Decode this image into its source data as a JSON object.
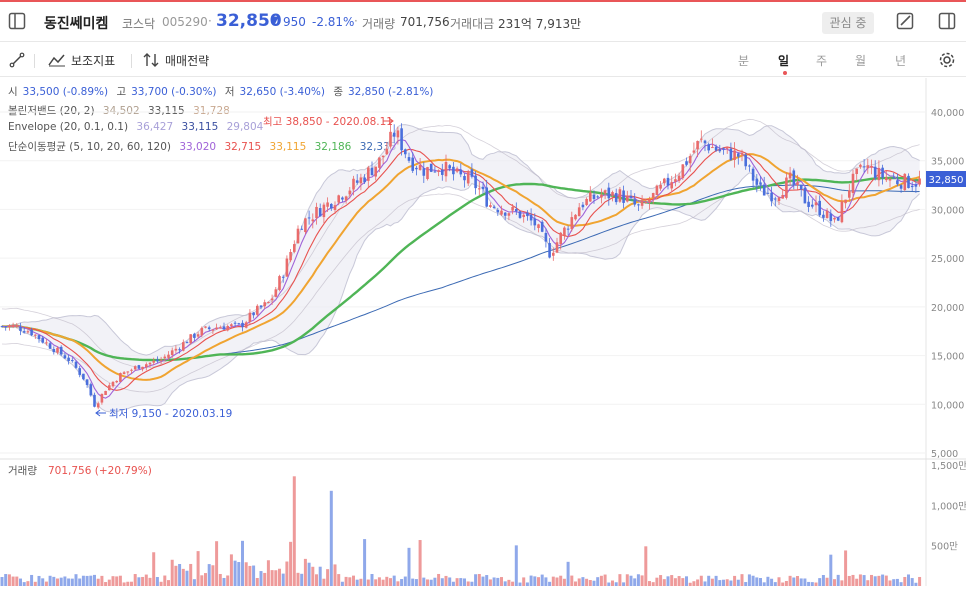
{
  "header": {
    "name": "동진쎄미켐",
    "market": "코스닥",
    "code": "005290",
    "separator": "·",
    "price": "32,850",
    "change_arrow": "▼",
    "change": "950",
    "change_pct": "-2.81%",
    "volume_label": "거래량",
    "volume": "701,756",
    "amount_label": "거래대금",
    "amount": "231억 7,913만",
    "watch_label": "관심 중"
  },
  "toolbar": {
    "indicators_label": "보조지표",
    "strategy_label": "매매전략",
    "periods": [
      "분",
      "일",
      "주",
      "월",
      "년"
    ],
    "active_period": "일"
  },
  "ohlc": {
    "open_label": "시",
    "open": "33,500 (-0.89%)",
    "high_label": "고",
    "high": "33,700 (-0.30%)",
    "low_label": "저",
    "low": "32,650 (-3.40%)",
    "close_label": "종",
    "close": "32,850 (-2.81%)"
  },
  "bollinger": {
    "label": "볼린저밴드 (20, 2)",
    "upper": "34,502",
    "mid": "33,115",
    "lower": "31,728"
  },
  "envelope": {
    "label": "Envelope (20, 0.1, 0.1)",
    "upper": "36,427",
    "mid": "33,115",
    "lower": "29,804"
  },
  "sma": {
    "label": "단순이동평균 (5, 10, 20, 60, 120)",
    "v5": "33,020",
    "v10": "32,715",
    "v20": "33,115",
    "v60": "32,186",
    "v120": "32,333"
  },
  "annotations": {
    "high": "최고 38,850 - 2020.08.11",
    "low": "최저 9,150 - 2020.03.19"
  },
  "volume_panel": {
    "label": "거래량",
    "value": "701,756 (+20.79%)"
  },
  "colors": {
    "up": "#e96b6b",
    "down": "#4a6fdc",
    "ma5": "#a063d8",
    "ma10": "#e8524f",
    "ma20": "#f0a431",
    "ma60": "#4fb556",
    "ma120": "#3c6ab4",
    "band": "#c8c8d8",
    "envelope": "#b8b0c0"
  },
  "chart_data": {
    "type": "candlestick",
    "price_axis": {
      "ticks": [
        5000,
        10000,
        15000,
        20000,
        25000,
        30000,
        35000,
        40000
      ],
      "tick_labels": [
        "5,000",
        "10,000",
        "15,000",
        "20,000",
        "25,000",
        "30,000",
        "35,000",
        "40,000"
      ],
      "last_price_label": "32,850",
      "last_price": 32850
    },
    "volume_axis": {
      "ticks": [
        500,
        1000,
        1500
      ],
      "tick_labels": [
        "500만",
        "1,000만",
        "1,500만"
      ],
      "unit": "만"
    },
    "close_path": [
      [
        0,
        18000
      ],
      [
        15,
        18000
      ],
      [
        30,
        17500
      ],
      [
        50,
        16000
      ],
      [
        70,
        14500
      ],
      [
        85,
        12500
      ],
      [
        95,
        9800
      ],
      [
        105,
        11500
      ],
      [
        120,
        13000
      ],
      [
        140,
        14000
      ],
      [
        160,
        14500
      ],
      [
        180,
        16000
      ],
      [
        200,
        17500
      ],
      [
        220,
        18000
      ],
      [
        240,
        18000
      ],
      [
        255,
        19500
      ],
      [
        270,
        20500
      ],
      [
        285,
        24000
      ],
      [
        300,
        28500
      ],
      [
        320,
        30000
      ],
      [
        340,
        31500
      ],
      [
        360,
        33000
      ],
      [
        380,
        35000
      ],
      [
        395,
        38000
      ],
      [
        410,
        35000
      ],
      [
        425,
        34000
      ],
      [
        440,
        34500
      ],
      [
        455,
        33500
      ],
      [
        470,
        33000
      ],
      [
        480,
        32000
      ],
      [
        490,
        30500
      ],
      [
        505,
        30000
      ],
      [
        520,
        29500
      ],
      [
        535,
        28500
      ],
      [
        550,
        25500
      ],
      [
        565,
        28000
      ],
      [
        580,
        30500
      ],
      [
        600,
        31500
      ],
      [
        620,
        31500
      ],
      [
        640,
        30000
      ],
      [
        660,
        32000
      ],
      [
        680,
        34000
      ],
      [
        700,
        37000
      ],
      [
        720,
        36000
      ],
      [
        740,
        35500
      ],
      [
        760,
        32000
      ],
      [
        775,
        31500
      ],
      [
        790,
        33000
      ],
      [
        805,
        31000
      ],
      [
        820,
        30000
      ],
      [
        835,
        28500
      ],
      [
        850,
        32500
      ],
      [
        865,
        34500
      ],
      [
        880,
        33500
      ],
      [
        895,
        33000
      ],
      [
        910,
        32800
      ],
      [
        922,
        32850
      ]
    ]
  }
}
